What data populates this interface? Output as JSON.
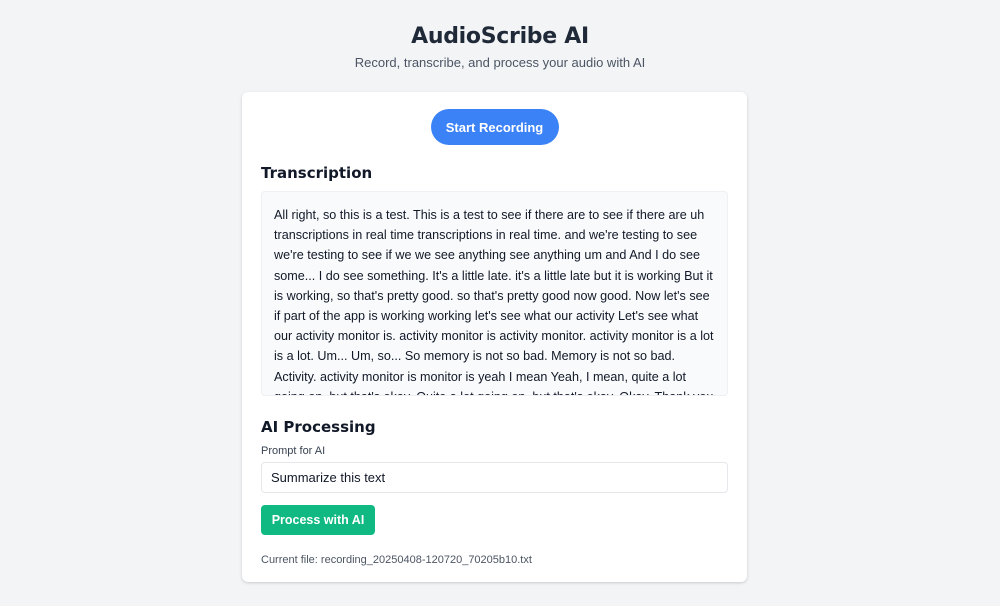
{
  "header": {
    "title": "AudioScribe AI",
    "subtitle": "Record, transcribe, and process your audio with AI"
  },
  "recording": {
    "button_label": "Start Recording"
  },
  "transcription": {
    "title": "Transcription",
    "text": "All right, so this is a test. This is a test to see if there are to see if there are uh transcriptions in real time transcriptions in real time. and we're testing to see we're testing to see if we we see anything see anything um and And I do see some... I do see something. It's a little late. it's a little late but it is working But it is working, so that's pretty good. so that's pretty good now good. Now let's see if part of the app is working working let's see what our activity Let's see what our activity monitor is. activity monitor is activity monitor. activity monitor is a lot is a lot. Um... Um, so... So memory is not so bad. Memory is not so bad. Activity. activity monitor is monitor is yeah I mean Yeah, I mean, quite a lot going on, but that's okay. Quite a lot going on, but that's okay. Okay. Thank you for watching!"
  },
  "ai_processing": {
    "title": "AI Processing",
    "prompt_label": "Prompt for AI",
    "prompt_value": "Summarize this text",
    "process_button_label": "Process with AI"
  },
  "file": {
    "label": "Current file: recording_20250408-120720_70205b10.txt"
  },
  "colors": {
    "primary": "#3b82f6",
    "success": "#10b981",
    "background": "#f3f4f6"
  }
}
